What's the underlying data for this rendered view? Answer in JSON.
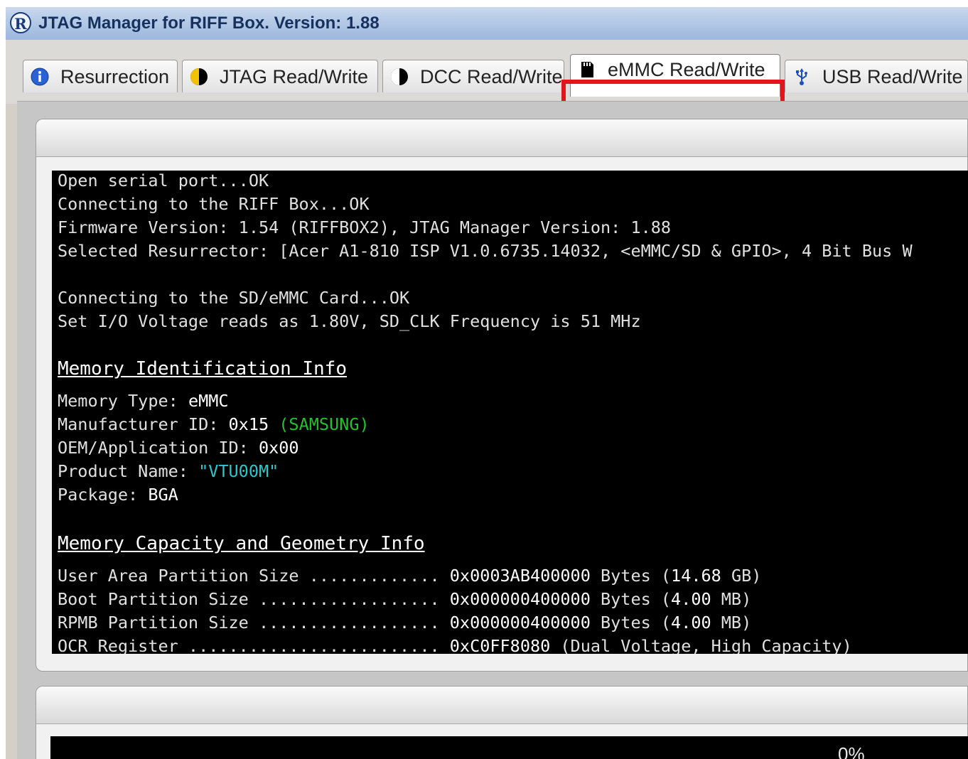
{
  "window": {
    "app_icon": "R",
    "title": "JTAG Manager for RIFF Box. Version: 1.88"
  },
  "tabs": [
    {
      "label": "Resurrection",
      "icon": "info-icon"
    },
    {
      "label": "JTAG Read/Write",
      "icon": "half-circle-yellow-icon"
    },
    {
      "label": "DCC Read/Write",
      "icon": "half-circle-icon"
    },
    {
      "label": "eMMC Read/Write",
      "icon": "sd-card-icon",
      "active": true
    },
    {
      "label": "USB Read/Write",
      "icon": "usb-icon"
    }
  ],
  "console": {
    "lines": [
      "Open serial port...OK",
      "Connecting to the RIFF Box...OK",
      "Firmware Version: 1.54 (RIFFBOX2), JTAG Manager Version: 1.88",
      "Selected Resurrector: [Acer A1-810 ISP V1.0.6735.14032, <eMMC/SD & GPIO>, 4 Bit Bus W",
      "Connecting to the SD/eMMC Card...OK",
      "Set I/O Voltage reads as 1.80V, SD_CLK Frequency is 51 MHz"
    ],
    "memory_id": {
      "heading": "Memory Identification Info",
      "type_label": "Memory Type: ",
      "type_value": "eMMC",
      "manufacturer_label": "Manufacturer ID: ",
      "manufacturer_value": "0x15",
      "manufacturer_name": "(SAMSUNG)",
      "oem_label": "OEM/Application ID: ",
      "oem_value": "0x00",
      "product_label": "Product Name: ",
      "product_value": "\"VTU00M\"",
      "package_label": "Package: ",
      "package_value": "BGA"
    },
    "capacity": {
      "heading": "Memory Capacity and Geometry Info",
      "rows": [
        {
          "label": "User Area Partition Size ............. ",
          "hex": "0x0003AB400000",
          "unit": " Bytes (",
          "size": "14.68",
          "tail": " GB)"
        },
        {
          "label": "Boot Partition Size .................. ",
          "hex": "0x000000400000",
          "unit": " Bytes (",
          "size": "4.00",
          "tail": " MB)"
        },
        {
          "label": "RPMB Partition Size .................. ",
          "hex": "0x000000400000",
          "unit": " Bytes (",
          "size": "4.00",
          "tail": " MB)"
        },
        {
          "label": "OCR Register ......................... ",
          "hex": "0xC0FF8080",
          "unit": " (Dual Voltage, High Capacity)",
          "size": "",
          "tail": ""
        }
      ]
    }
  },
  "progress": {
    "percent_text": "0%",
    "value": 0
  },
  "colors": {
    "highlight": "#e4141c",
    "console_bg": "#000000",
    "manufacturer_name": "#22c22a",
    "product_name": "#28c8cc"
  }
}
